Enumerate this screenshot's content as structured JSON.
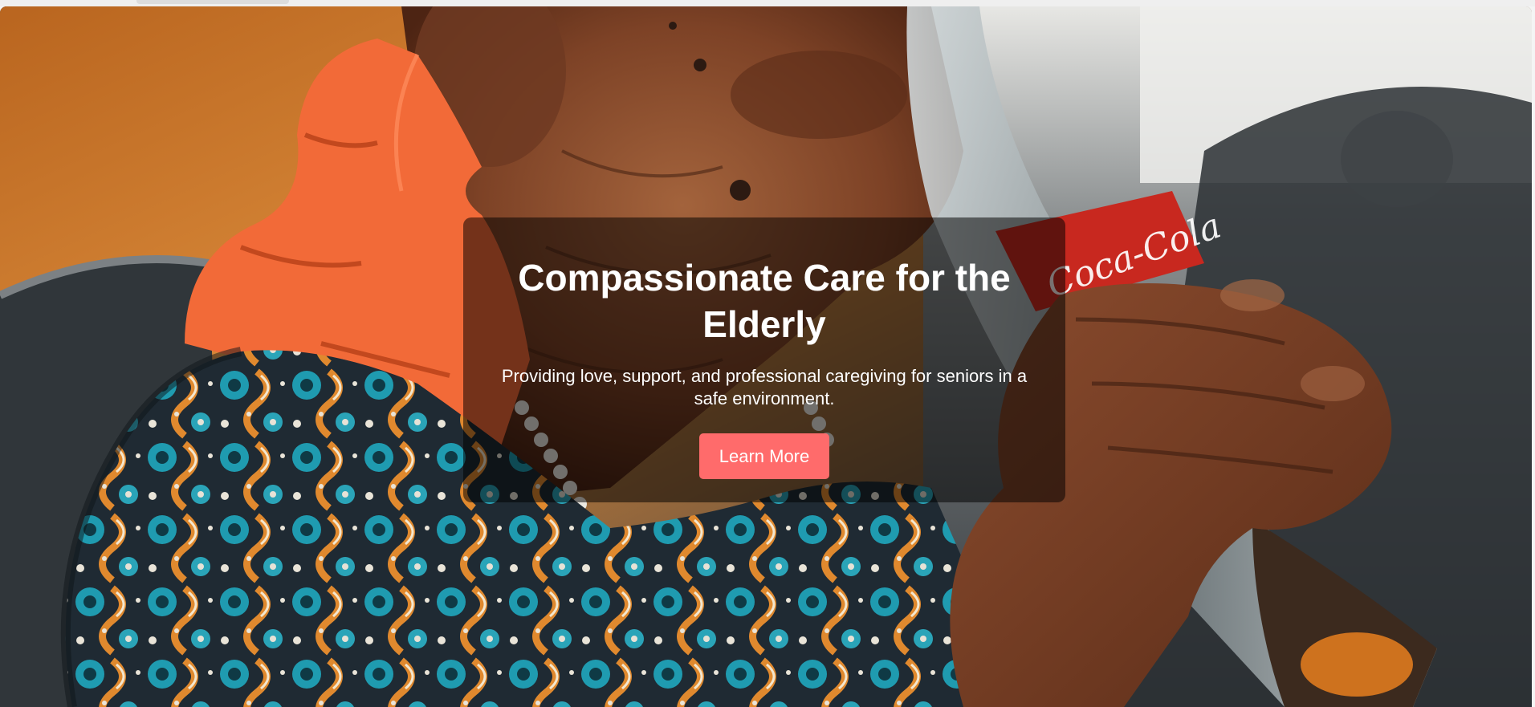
{
  "hero": {
    "title": "Compassionate Care for the Elderly",
    "subtitle": "Providing love, support, and professional caregiving for seniors in a safe environment.",
    "cta_label": "Learn More",
    "colors": {
      "cta_background": "#ff6b6b",
      "overlay": "rgba(0,0,0,0.52)",
      "text": "#ffffff"
    },
    "image": {
      "bottle_label": "Coca-Cola"
    }
  }
}
